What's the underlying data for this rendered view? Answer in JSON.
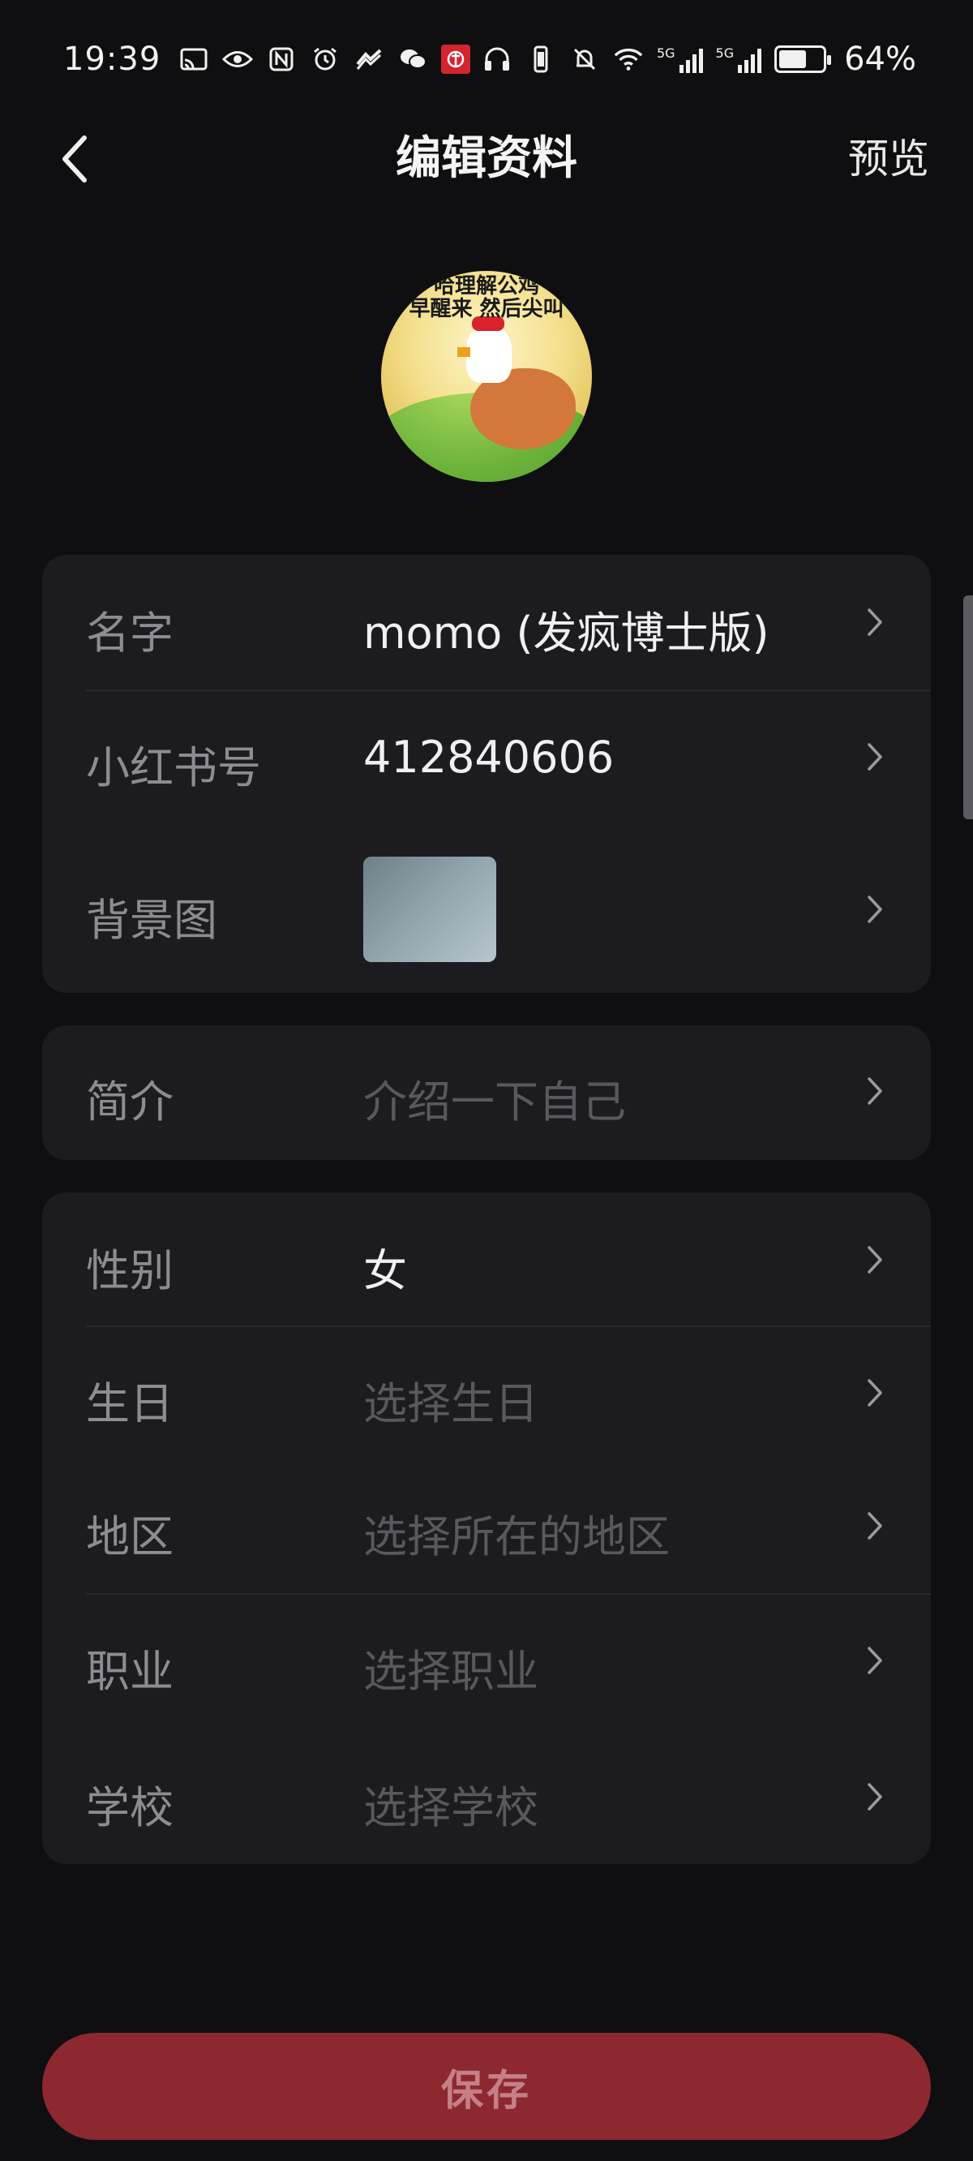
{
  "status_bar": {
    "time": "19:39",
    "left_icons": [
      "cast-icon",
      "eye-icon",
      "nfc-icon",
      "alarm-icon",
      "vpn-icon",
      "wechat-icon",
      "metro-icon"
    ],
    "right_icons": [
      "headphones-icon",
      "vibrate-icon",
      "mute-icon",
      "wifi-icon",
      "signal-5g-icon",
      "signal-5g-icon-2",
      "battery-icon"
    ],
    "network_label_1": "5G",
    "network_label_2": "5G",
    "battery_percent": "64%",
    "battery_level": 0.64
  },
  "header": {
    "title": "编辑资料",
    "preview_label": "预览"
  },
  "avatar": {
    "caption_line1": "哈理解公鸡",
    "caption_line2": "早醒来 然后尖叫"
  },
  "profile_card": {
    "rows": [
      {
        "label": "名字",
        "value": "momo (发疯博士版)"
      },
      {
        "label": "小红书号",
        "value": "412840606"
      },
      {
        "label": "背景图",
        "value": ""
      }
    ]
  },
  "bio_card": {
    "label": "简介",
    "placeholder": "介绍一下自己"
  },
  "details_card": {
    "rows": [
      {
        "label": "性别",
        "value": "女",
        "is_placeholder": false
      },
      {
        "label": "生日",
        "value": "选择生日",
        "is_placeholder": true
      },
      {
        "label": "地区",
        "value": "选择所在的地区",
        "is_placeholder": true
      },
      {
        "label": "职业",
        "value": "选择职业",
        "is_placeholder": true
      },
      {
        "label": "学校",
        "value": "选择学校",
        "is_placeholder": true
      }
    ]
  },
  "save_button_label": "保存",
  "colors": {
    "background": "#0f0f11",
    "card": "#1c1c20",
    "save_button": "#8d2830",
    "save_text": "#c48086"
  }
}
